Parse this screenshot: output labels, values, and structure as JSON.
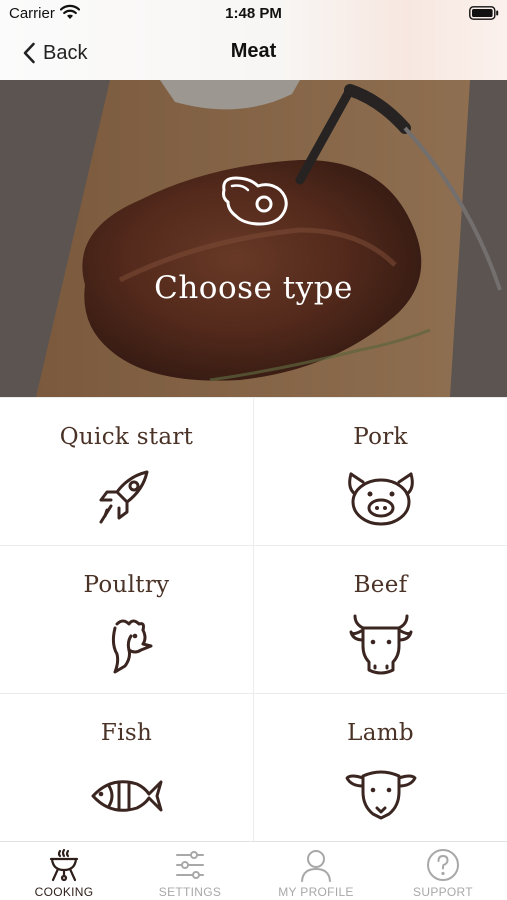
{
  "status_bar": {
    "carrier": "Carrier",
    "time": "1:48 PM",
    "icons": [
      "wifi-icon",
      "battery-icon"
    ]
  },
  "nav": {
    "back_label": "Back",
    "title": "Meat"
  },
  "hero": {
    "title": "Choose type",
    "icon": "steak-icon"
  },
  "types": [
    {
      "label": "Quick start",
      "icon": "rocket-icon"
    },
    {
      "label": "Pork",
      "icon": "pig-icon"
    },
    {
      "label": "Poultry",
      "icon": "rooster-icon"
    },
    {
      "label": "Beef",
      "icon": "cow-icon"
    },
    {
      "label": "Fish",
      "icon": "fish-icon"
    },
    {
      "label": "Lamb",
      "icon": "lamb-icon"
    }
  ],
  "tabs": [
    {
      "label": "COOKING",
      "icon": "grill-icon",
      "active": true
    },
    {
      "label": "SETTINGS",
      "icon": "sliders-icon",
      "active": false
    },
    {
      "label": "MY PROFILE",
      "icon": "person-icon",
      "active": false
    },
    {
      "label": "SUPPORT",
      "icon": "question-icon",
      "active": false
    }
  ],
  "colors": {
    "icon_brown": "#3a2520",
    "label_brown": "#4a3226",
    "tab_active": "#2e1f1a",
    "tab_inactive": "#a8a8a8",
    "divider": "#ececec"
  }
}
